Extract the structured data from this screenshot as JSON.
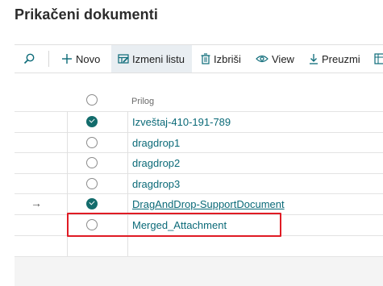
{
  "page": {
    "title": "Prikačeni dokumenti"
  },
  "toolbar": {
    "search_icon": "search-icon",
    "new_label": "Novo",
    "edit_list_label": "Izmeni listu",
    "delete_label": "Izbriši",
    "view_label": "View",
    "download_label": "Preuzmi"
  },
  "list": {
    "column_header": "Prilog",
    "rows": [
      {
        "name": "Izveštaj-410-191-789",
        "selected": true
      },
      {
        "name": "dragdrop1",
        "selected": false
      },
      {
        "name": "dragdrop2",
        "selected": false
      },
      {
        "name": "dragdrop3",
        "selected": false
      },
      {
        "name": "DragAndDrop-SupportDocument",
        "selected": true,
        "current": true
      },
      {
        "name": "Merged_Attachment",
        "selected": false,
        "highlighted": true
      }
    ]
  },
  "colors": {
    "accent": "#136c6c",
    "link": "#0b6a78",
    "highlight_border": "#e01b24"
  }
}
